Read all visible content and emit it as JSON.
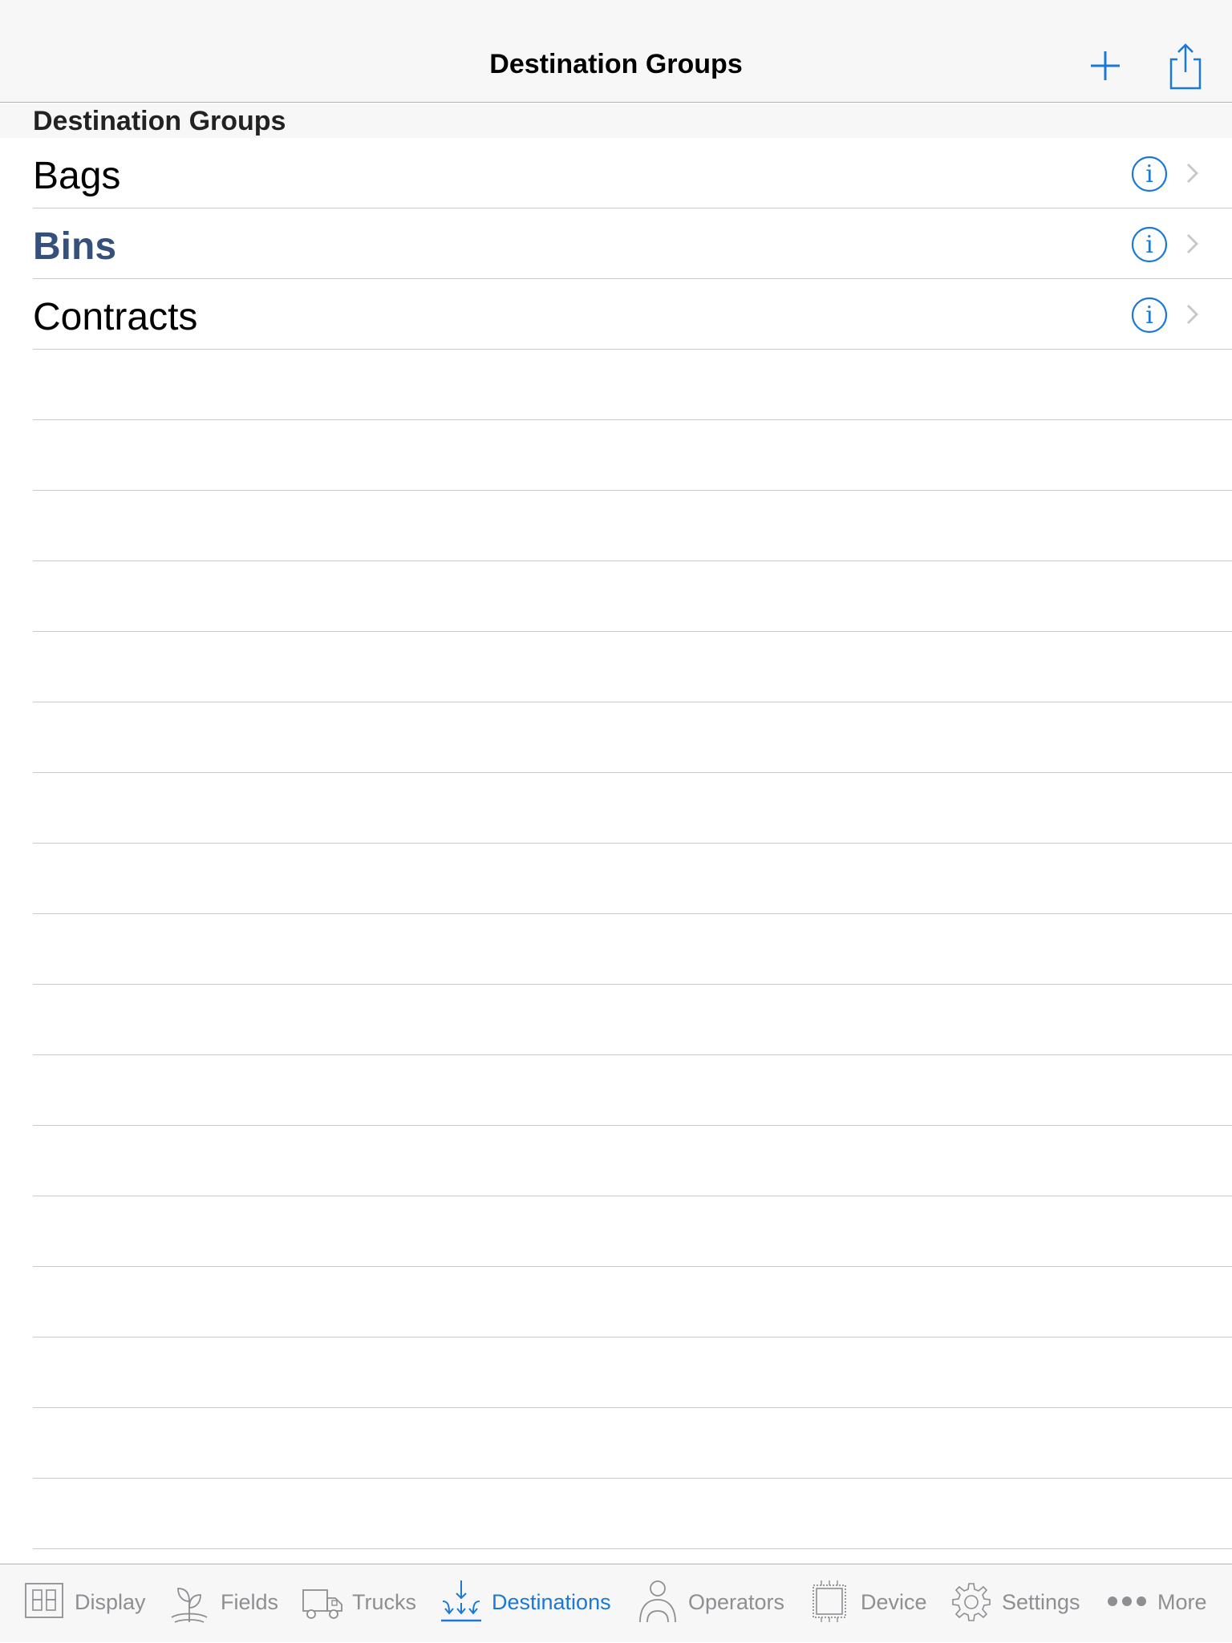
{
  "navbar": {
    "title": "Destination Groups"
  },
  "section": {
    "header": "Destination Groups"
  },
  "rows": [
    {
      "label": "Bags"
    },
    {
      "label": "Bins"
    },
    {
      "label": "Contracts"
    }
  ],
  "tabs": [
    {
      "label": "Display",
      "icon": "display-digits-icon"
    },
    {
      "label": "Fields",
      "icon": "plant-icon"
    },
    {
      "label": "Trucks",
      "icon": "truck-icon"
    },
    {
      "label": "Destinations",
      "icon": "destinations-arrows-icon"
    },
    {
      "label": "Operators",
      "icon": "operator-person-icon"
    },
    {
      "label": "Device",
      "icon": "chip-icon"
    },
    {
      "label": "Settings",
      "icon": "gear-icon"
    },
    {
      "label": "More",
      "icon": "more-dots-icon"
    }
  ],
  "colors": {
    "accent": "#1a78d6",
    "selected_text": "#35507a",
    "inactive_tab": "#8e8e93",
    "separator": "#c8c7cc",
    "bar_background": "#f7f7f7"
  }
}
